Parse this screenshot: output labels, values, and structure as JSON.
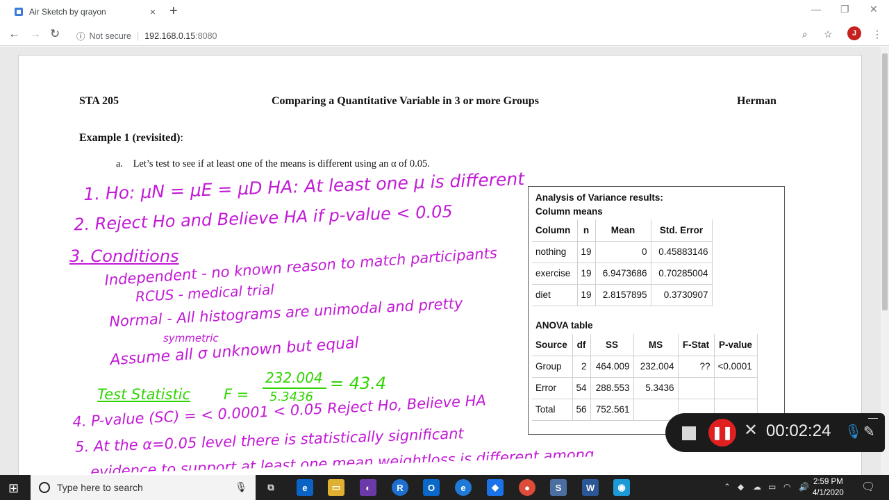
{
  "browser": {
    "tab_title": "Air Sketch by qrayon",
    "tab_close": "×",
    "new_tab": "+",
    "not_secure": "Not secure",
    "url_host": "192.168.0.15",
    "url_port": ":8080",
    "avatar_letter": "J"
  },
  "doc": {
    "course": "STA 205",
    "title": "Comparing a Quantitative Variable in 3 or more Groups",
    "author": "Herman",
    "example_bold": "Example 1 (revisited)",
    "example_colon": ":",
    "question_label": "a.",
    "question_text": "Let’s test to see if at least one of the means is different using an α of 0.05."
  },
  "handwriting": {
    "l1": "1. Ho: μN = μE = μD    HA: At least one μ is different",
    "l2": "2. Reject Ho and Believe HA if p-value < 0.05",
    "l3": "3. Conditions",
    "l4": "Independent - no known reason to match participants",
    "l5": "RCUS - medical trial",
    "l6": "Normal - All histograms are unimodal and pretty",
    "l7": "symmetric",
    "l8": "Assume all σ unknown but equal",
    "l9a": "Test Statistic",
    "l9b": "F =",
    "l9num": "232.004",
    "l9den": "5.3436",
    "l9eq": "= 43.4",
    "l10": "4. P-value (SC) = < 0.0001 < 0.05  Reject Ho, Believe HA",
    "l11": "5. At the α=0.05 level there is statistically significant",
    "l12": "evidence to support at least one mean weightloss is different among"
  },
  "anova_panel": {
    "title": "Analysis of Variance results:",
    "means_title": "Column means",
    "means_headers": [
      "Column",
      "n",
      "Mean",
      "Std. Error"
    ],
    "means_rows": [
      [
        "nothing",
        "19",
        "0",
        "0.45883146"
      ],
      [
        "exercise",
        "19",
        "6.9473686",
        "0.70285004"
      ],
      [
        "diet",
        "19",
        "2.8157895",
        "0.3730907"
      ]
    ],
    "table_title": "ANOVA table",
    "anova_headers": [
      "Source",
      "df",
      "SS",
      "MS",
      "F-Stat",
      "P-value"
    ],
    "anova_rows": [
      [
        "Group",
        "2",
        "464.009",
        "232.004",
        "??",
        "<0.0001"
      ],
      [
        "Error",
        "54",
        "288.553",
        "5.3436",
        "",
        ""
      ],
      [
        "Total",
        "56",
        "752.561",
        "",
        "",
        ""
      ]
    ]
  },
  "recorder": {
    "time": "00:02:24"
  },
  "taskbar": {
    "search_placeholder": "Type here to search",
    "time": "2:59 PM",
    "date": "4/1/2020"
  }
}
